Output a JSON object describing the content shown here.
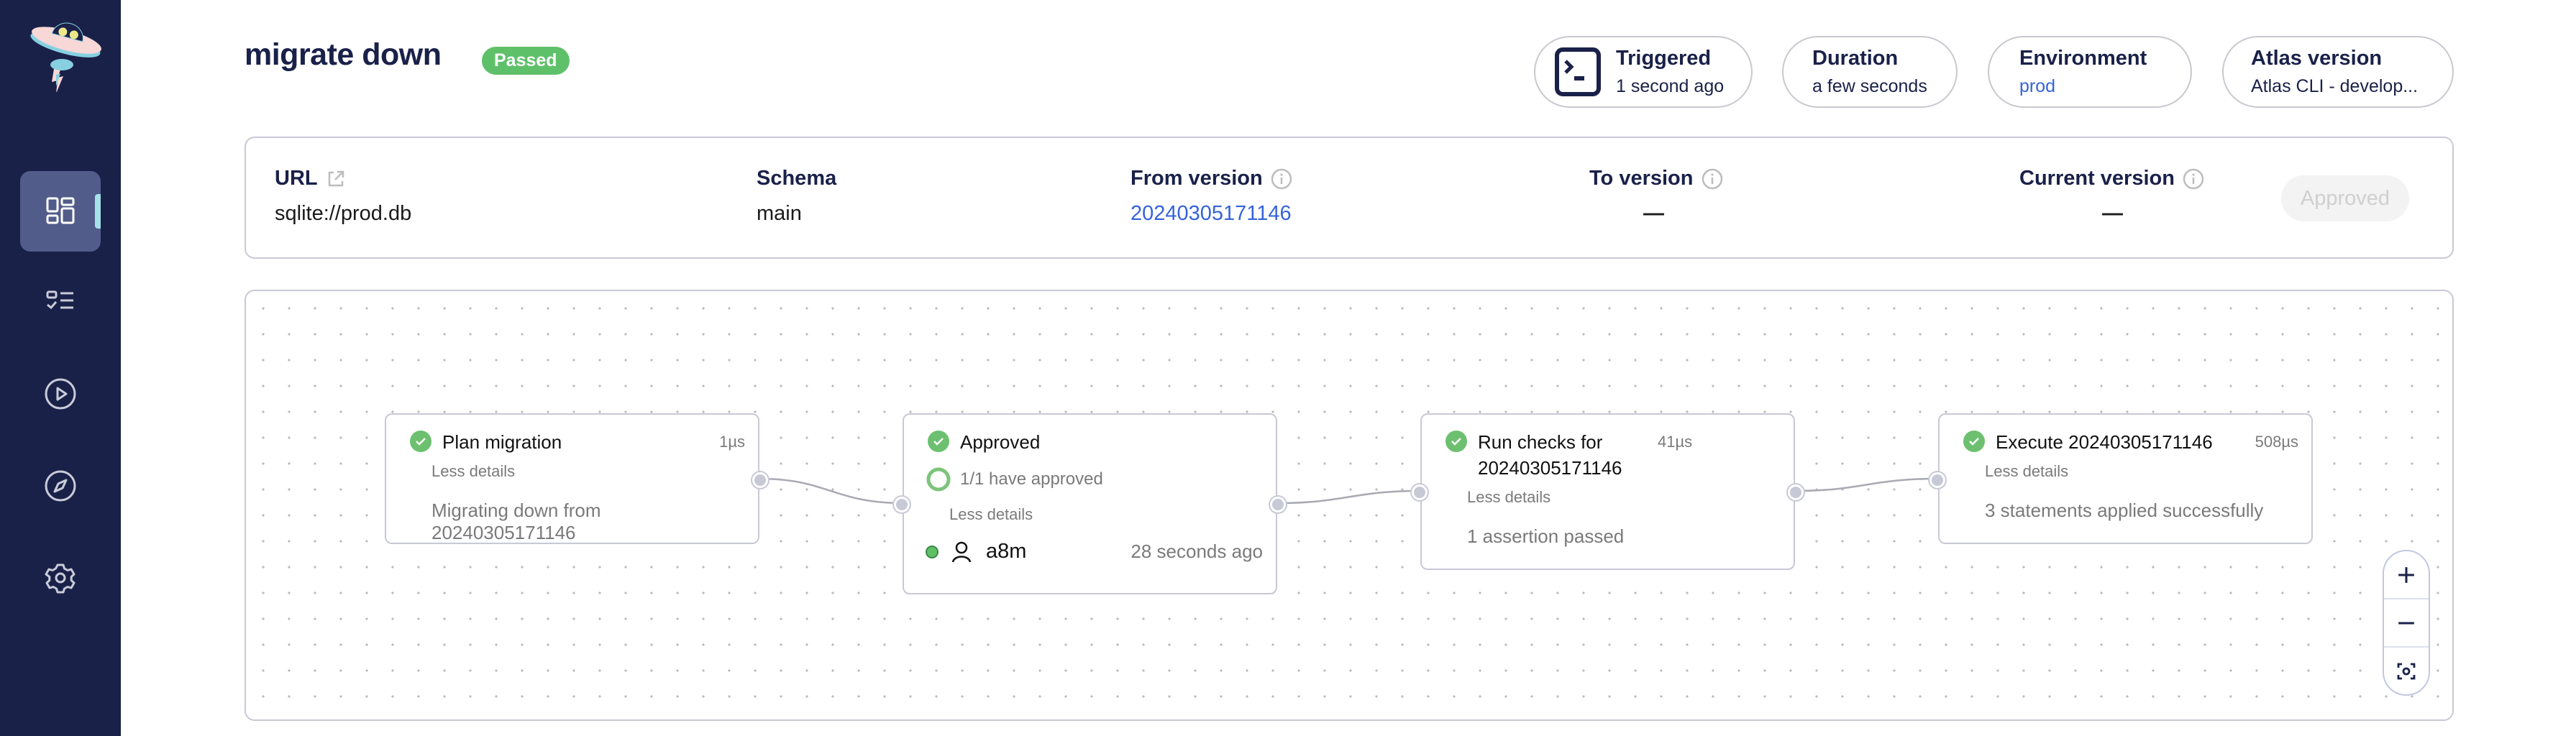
{
  "sidebar": {
    "logo": "atlas-ufo-logo",
    "items": [
      {
        "name": "dashboard",
        "icon": "dashboard-icon",
        "active": true
      },
      {
        "name": "checklist",
        "icon": "checklist-icon",
        "active": false
      },
      {
        "name": "runs",
        "icon": "play-circle-icon",
        "active": false
      },
      {
        "name": "explore",
        "icon": "compass-icon",
        "active": false
      },
      {
        "name": "settings",
        "icon": "gear-icon",
        "active": false
      }
    ]
  },
  "header": {
    "title": "migrate down",
    "status": "Passed",
    "status_color": "#5fc06a",
    "pills": [
      {
        "label": "Triggered",
        "value": "1 second ago",
        "icon": "terminal-icon"
      },
      {
        "label": "Duration",
        "value": "a few seconds"
      },
      {
        "label": "Environment",
        "value": "prod"
      },
      {
        "label": "Atlas version",
        "value": "Atlas CLI - develop..."
      }
    ]
  },
  "info": {
    "url_label": "URL",
    "url_value": "sqlite://prod.db",
    "schema_label": "Schema",
    "schema_value": "main",
    "from_label": "From version",
    "from_value": "20240305171146",
    "to_label": "To version",
    "to_value": "—",
    "current_label": "Current version",
    "current_value": "—",
    "approve_button": "Approved"
  },
  "flow": {
    "nodes": [
      {
        "title": "Plan migration",
        "duration": "1µs",
        "less": "Less details",
        "description": "Migrating down from 20240305171146"
      },
      {
        "title": "Approved",
        "approvals": "1/1 have approved",
        "less": "Less details",
        "approver": "a8m",
        "approved_at": "28 seconds ago"
      },
      {
        "title": "Run checks for 20240305171146",
        "duration": "41µs",
        "less": "Less details",
        "description": "1 assertion passed"
      },
      {
        "title": "Execute 20240305171146",
        "duration": "508µs",
        "less": "Less details",
        "description": "3 statements applied successfully"
      }
    ],
    "controls": {
      "zoom_in": "zoom-in",
      "zoom_out": "zoom-out",
      "fit": "fit-view"
    }
  },
  "colors": {
    "sidebar": "#1a2149",
    "accent": "#3563d8",
    "success": "#5fc06a",
    "active_nav": "#525c8a",
    "indicator": "#a6e1ea"
  }
}
